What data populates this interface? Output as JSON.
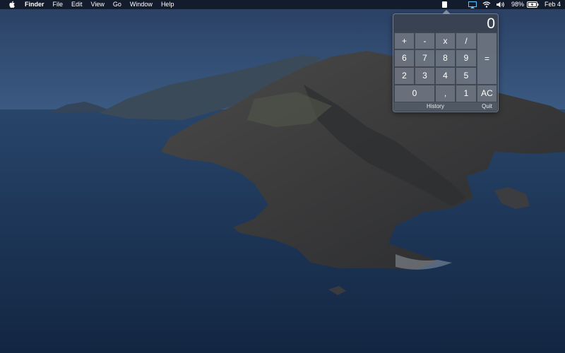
{
  "menubar": {
    "apple_icon": "apple-logo-icon",
    "app_name": "Finder",
    "menus": [
      "File",
      "Edit",
      "View",
      "Go",
      "Window",
      "Help"
    ],
    "status": {
      "calculator_icon": "calculator-menu-icon",
      "airplay_icon": "airplay-icon",
      "wifi_icon": "wifi-icon",
      "volume_icon": "volume-icon",
      "battery_percent": "98%",
      "battery_icon": "battery-charging-icon",
      "date": "Feb 4"
    }
  },
  "calculator": {
    "display": "0",
    "keys": {
      "plus": "+",
      "minus": "-",
      "multiply": "x",
      "divide": "/",
      "six": "6",
      "seven": "7",
      "eight": "8",
      "nine": "9",
      "two": "2",
      "three": "3",
      "four": "4",
      "five": "5",
      "zero": "0",
      "comma": ",",
      "one": "1",
      "equals": "=",
      "clear": "AC"
    },
    "footer": {
      "history": "History",
      "quit": "Quit"
    }
  }
}
